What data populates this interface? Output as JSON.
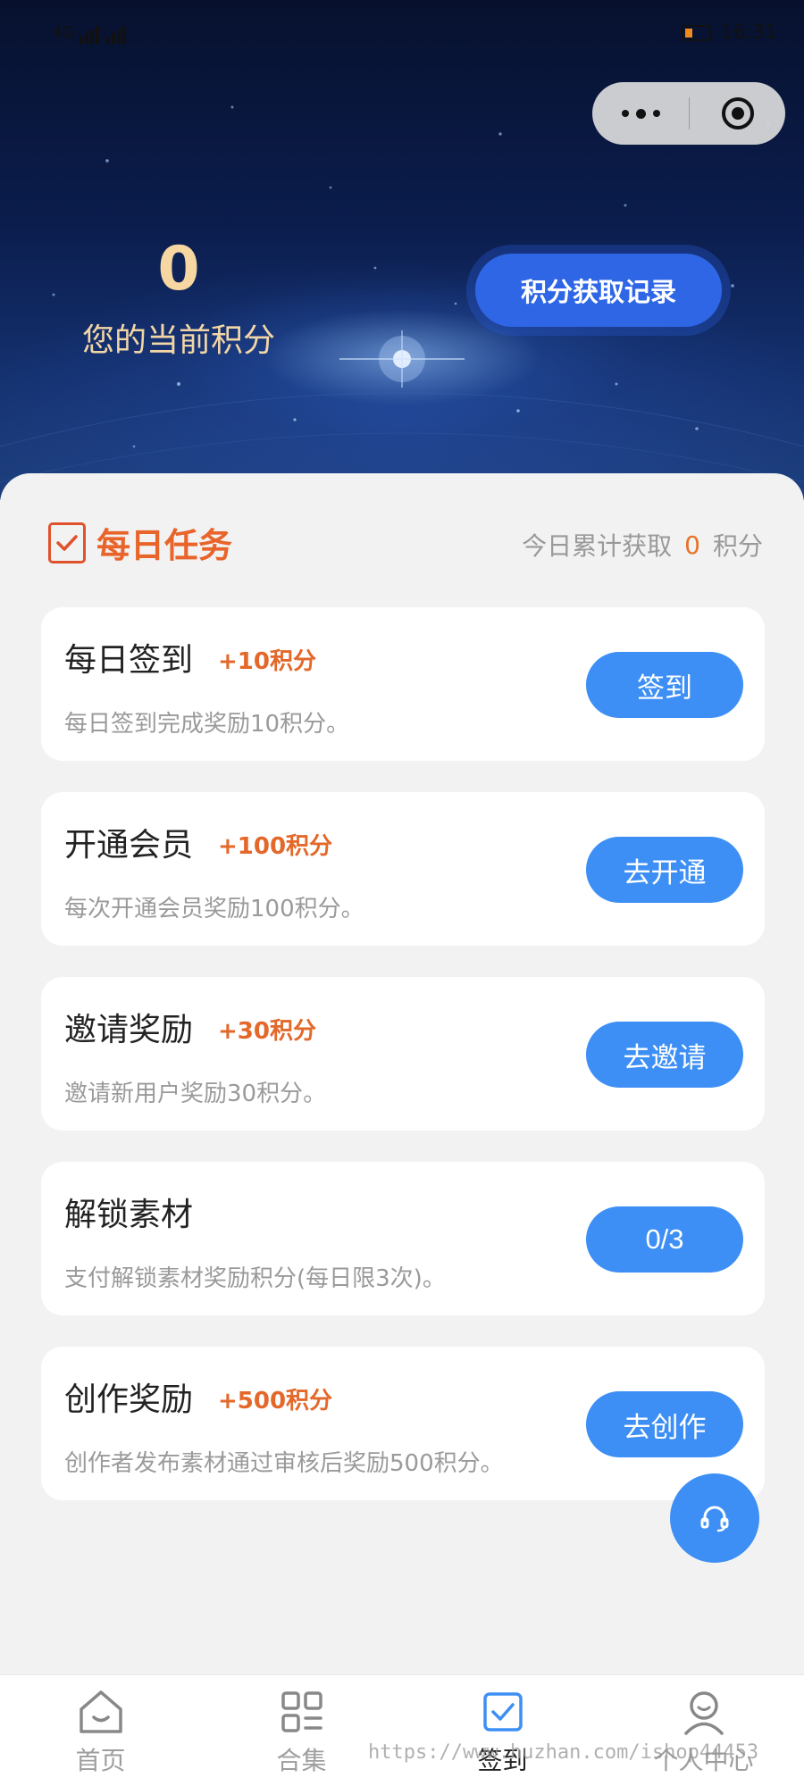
{
  "status_bar": {
    "left_text": "4G",
    "right_text": "16:31"
  },
  "capsule": {
    "more_icon": "more-dots-icon",
    "close_icon": "target-icon"
  },
  "hero": {
    "points_value": "0",
    "points_label": "您的当前积分",
    "record_button": "积分获取记录"
  },
  "daily": {
    "title": "每日任务",
    "today_prefix": "今日累计获取",
    "today_value": "0",
    "today_suffix": "积分"
  },
  "tasks": [
    {
      "title": "每日签到",
      "reward": "+10积分",
      "desc": "每日签到完成奖励10积分。",
      "button": "签到"
    },
    {
      "title": "开通会员",
      "reward": "+100积分",
      "desc": "每次开通会员奖励100积分。",
      "button": "去开通"
    },
    {
      "title": "邀请奖励",
      "reward": "+30积分",
      "desc": "邀请新用户奖励30积分。",
      "button": "去邀请"
    },
    {
      "title": "解锁素材",
      "reward": "",
      "desc": "支付解锁素材奖励积分(每日限3次)。",
      "button": "0/3"
    },
    {
      "title": "创作奖励",
      "reward": "+500积分",
      "desc": "创作者发布素材通过审核后奖励500积分。",
      "button": "去创作"
    }
  ],
  "service_icon": "headset-icon",
  "tabbar": [
    {
      "label": "首页",
      "icon": "home-icon"
    },
    {
      "label": "合集",
      "icon": "grid-list-icon"
    },
    {
      "label": "签到",
      "icon": "checkin-icon",
      "active": true
    },
    {
      "label": "个人中心",
      "icon": "user-icon"
    }
  ],
  "watermark": "https://www.huzhan.com/ishop44453",
  "colors": {
    "accent_blue": "#3d8ff5",
    "record_blue": "#2f66e6",
    "orange": "#e8642a",
    "gold": "#f7d7a1"
  }
}
